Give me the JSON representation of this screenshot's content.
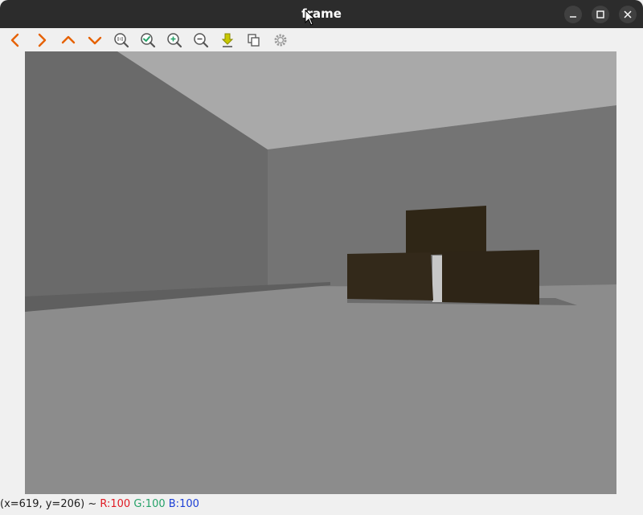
{
  "window": {
    "title": "frame",
    "controls": [
      "minimize-icon",
      "maximize-icon",
      "close-icon"
    ]
  },
  "toolbar": {
    "buttons": [
      {
        "name": "pan-left",
        "icon": "chevron-left-icon"
      },
      {
        "name": "pan-right",
        "icon": "chevron-right-icon"
      },
      {
        "name": "pan-up",
        "icon": "chevron-up-icon"
      },
      {
        "name": "pan-down",
        "icon": "chevron-down-icon"
      },
      {
        "name": "zoom-original",
        "icon": "zoom-100-icon"
      },
      {
        "name": "zoom-fit",
        "icon": "zoom-fit-icon"
      },
      {
        "name": "zoom-in",
        "icon": "zoom-in-icon"
      },
      {
        "name": "zoom-out",
        "icon": "zoom-out-icon"
      },
      {
        "name": "save-image",
        "icon": "download-icon"
      },
      {
        "name": "copy-image",
        "icon": "copy-icon"
      },
      {
        "name": "properties",
        "icon": "gear-icon"
      }
    ],
    "accent_color": "#e66100"
  },
  "status": {
    "coords": "(x=619, y=206) ~",
    "r": "R:100",
    "g": "G:100",
    "b": "B:100"
  },
  "colors": {
    "titlebar": "#2c2c2c",
    "r_text": "#e01b24",
    "g_text": "#26a269",
    "b_text": "#1c3fd6"
  }
}
